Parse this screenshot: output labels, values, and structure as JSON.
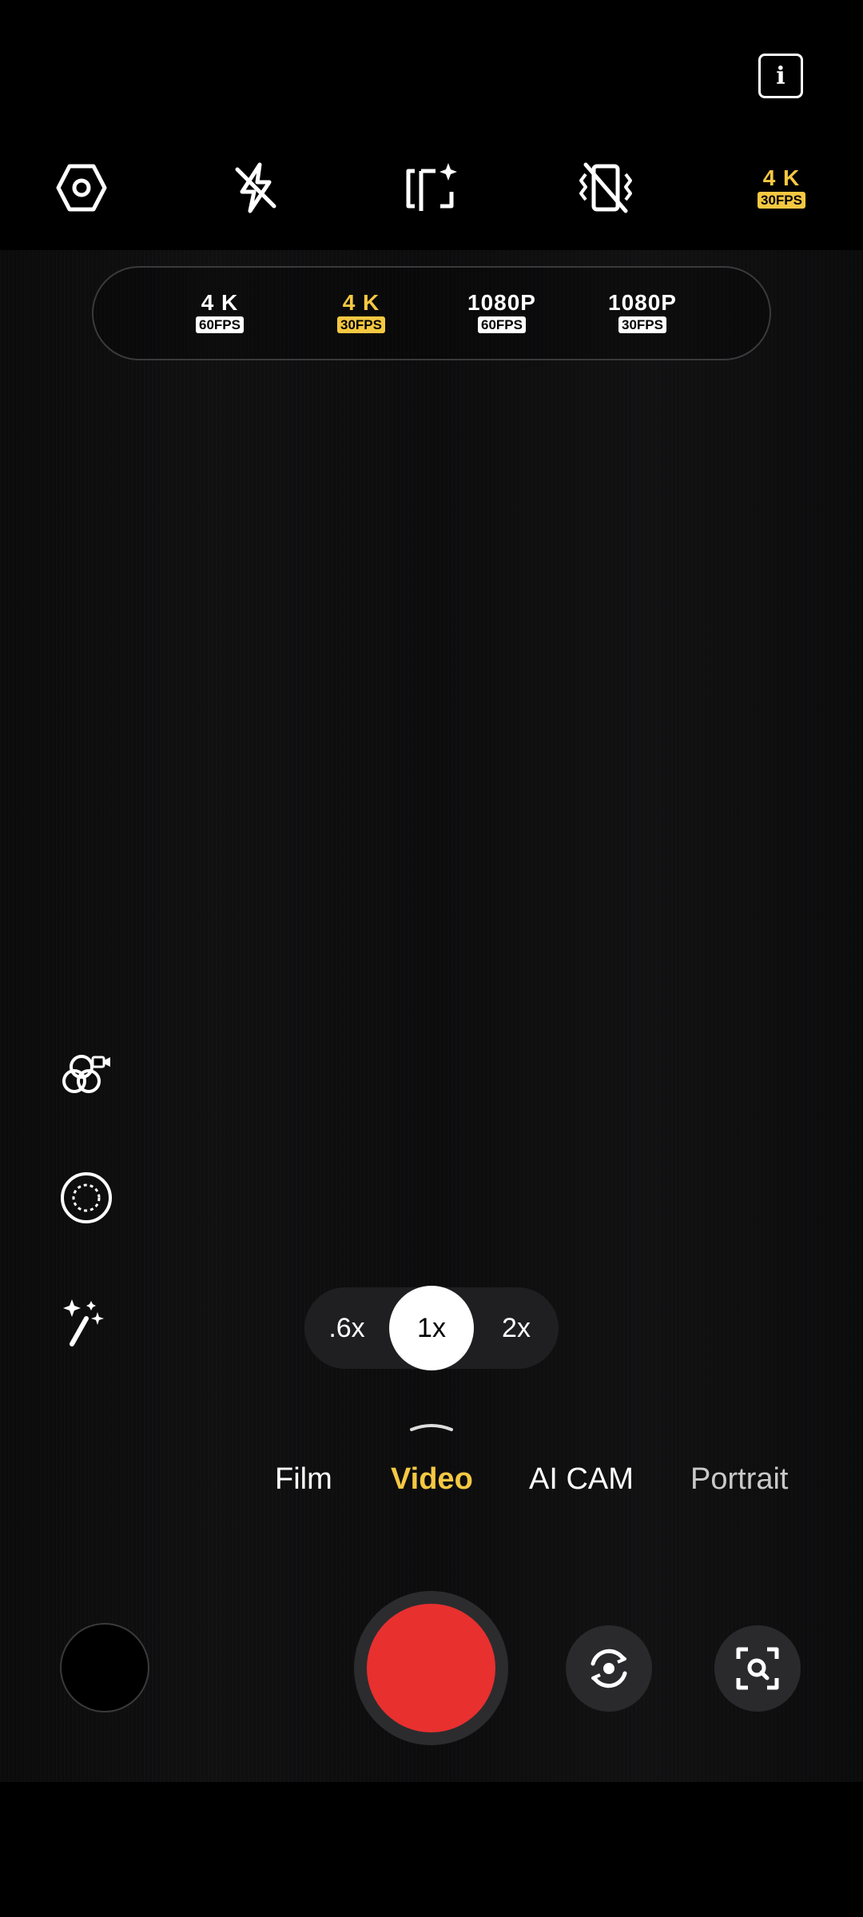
{
  "top_bar": {
    "info_label": "i",
    "icons": [
      "settings-icon",
      "flash-off-icon",
      "ai-frame-icon",
      "stabilization-off-icon"
    ],
    "current_resolution": {
      "res": "4 K",
      "fps": "30FPS"
    }
  },
  "resolution_picker": {
    "options": [
      {
        "res": "4 K",
        "fps": "60FPS",
        "selected": false
      },
      {
        "res": "4 K",
        "fps": "30FPS",
        "selected": true
      },
      {
        "res": "1080P",
        "fps": "60FPS",
        "selected": false
      },
      {
        "res": "1080P",
        "fps": "30FPS",
        "selected": false
      }
    ]
  },
  "side_tools": [
    "filters-icon",
    "portrait-lens-icon",
    "beauty-wand-icon"
  ],
  "zoom": {
    "options": [
      ".6x",
      "1x",
      "2x"
    ],
    "selected": "1x"
  },
  "modes": {
    "items": [
      "Film",
      "Video",
      "AI CAM",
      "Portrait"
    ],
    "selected": "Video"
  },
  "bottom": {
    "icons": [
      "gallery-thumbnail",
      "record-button",
      "switch-camera-icon",
      "lens-scan-icon"
    ]
  },
  "colors": {
    "accent": "#f5c842",
    "record": "#e8302f",
    "background": "#000000"
  }
}
